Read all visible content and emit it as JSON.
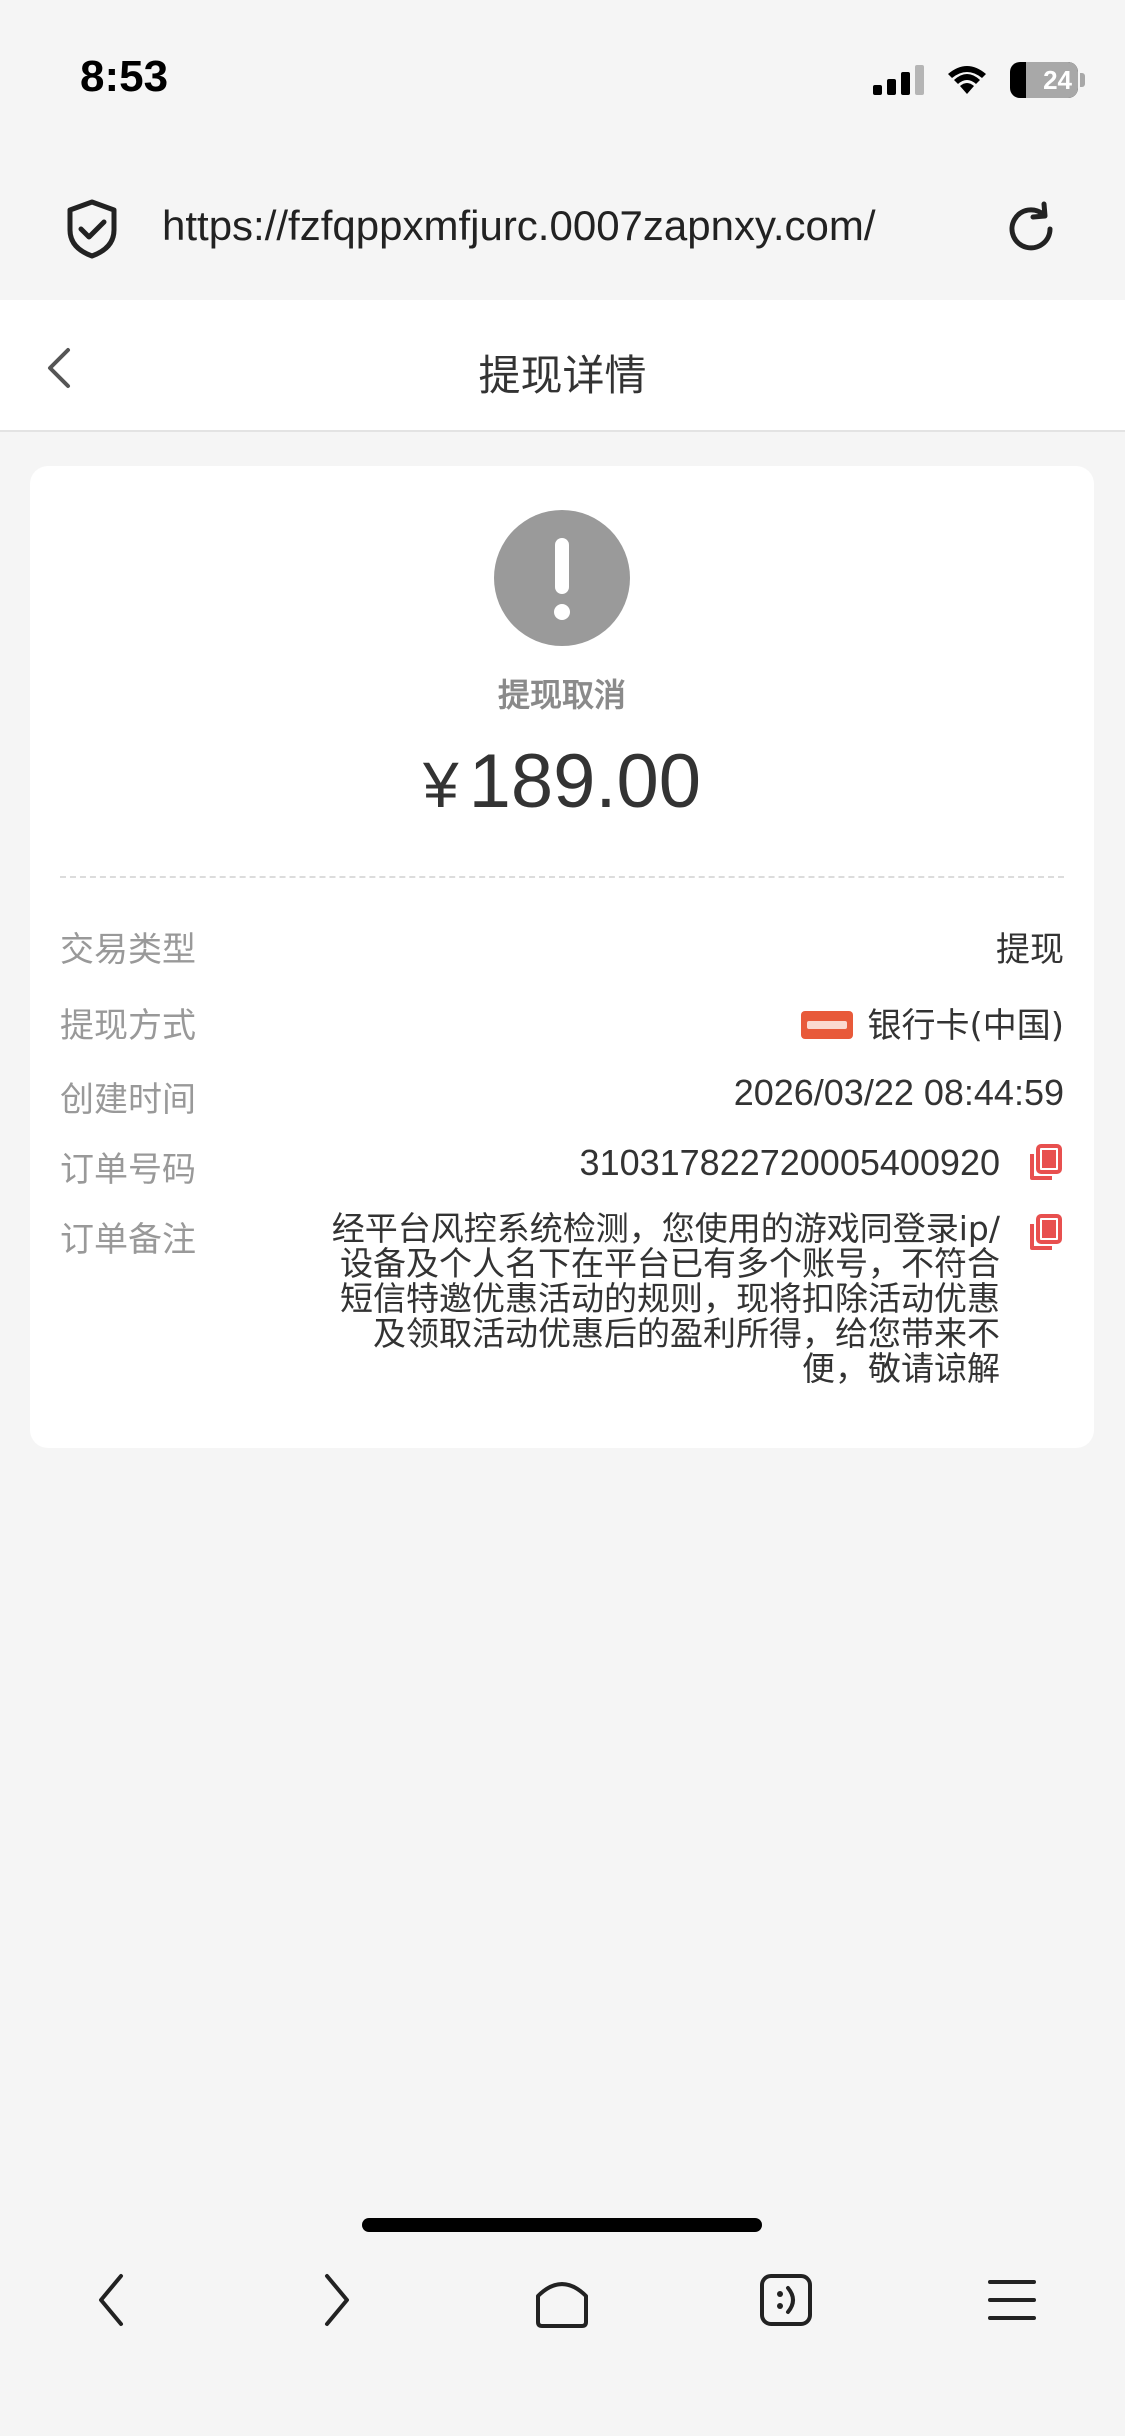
{
  "status_bar": {
    "time": "8:53",
    "battery": "24",
    "icons": [
      "cellular-signal-icon",
      "wifi-icon",
      "battery-icon"
    ]
  },
  "browser": {
    "url": "https://fzfqppxmfjurc.0007zapnxy.com/"
  },
  "page": {
    "title": "提现详情"
  },
  "detail": {
    "status": "提现取消",
    "currency_symbol": "¥",
    "amount": "189.00",
    "rows": [
      {
        "label": "交易类型",
        "value": "提现"
      },
      {
        "label": "提现方式",
        "value": "银行卡(中国)"
      },
      {
        "label": "创建时间",
        "value": "2026/03/22 08:44:59"
      },
      {
        "label": "订单号码",
        "value": "310317822720005400920"
      },
      {
        "label": "订单备注",
        "value": "经平台风控系统检测，您使用的游戏同登录ip/设备及个人名下在平台已有多个账号，不符合短信特邀优惠活动的规则，现将扣除活动优惠及领取活动优惠后的盈利所得，给您带来不便，敬请谅解"
      }
    ]
  },
  "colors": {
    "accent_red": "#e8504f",
    "status_gray": "#9a9a9a",
    "background": "#f5f5f5"
  },
  "bottom_toolbar": [
    "back-icon",
    "forward-icon",
    "home-icon",
    "tabs-icon",
    "menu-icon"
  ]
}
